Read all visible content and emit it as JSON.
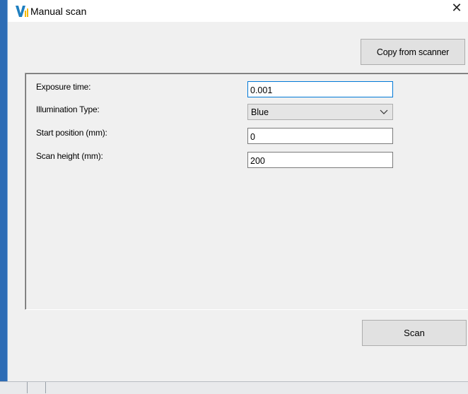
{
  "window": {
    "title": "Manual scan",
    "close_glyph": "✕",
    "app_icon": "app-logo-icon"
  },
  "toolbar": {
    "copy_label": "Copy from scanner"
  },
  "form": {
    "exposure_label": "Exposure time:",
    "exposure_value": "0.001",
    "illumination_label": "Illumination Type:",
    "illumination_value": "Blue",
    "start_label": "Start position (mm):",
    "start_value": "0",
    "height_label": "Scan height (mm):",
    "height_value": "200"
  },
  "actions": {
    "scan_label": "Scan"
  },
  "colors": {
    "focus_border": "#0078d7",
    "window_bg": "#f0f0f0",
    "button_bg": "#e1e1e1"
  }
}
